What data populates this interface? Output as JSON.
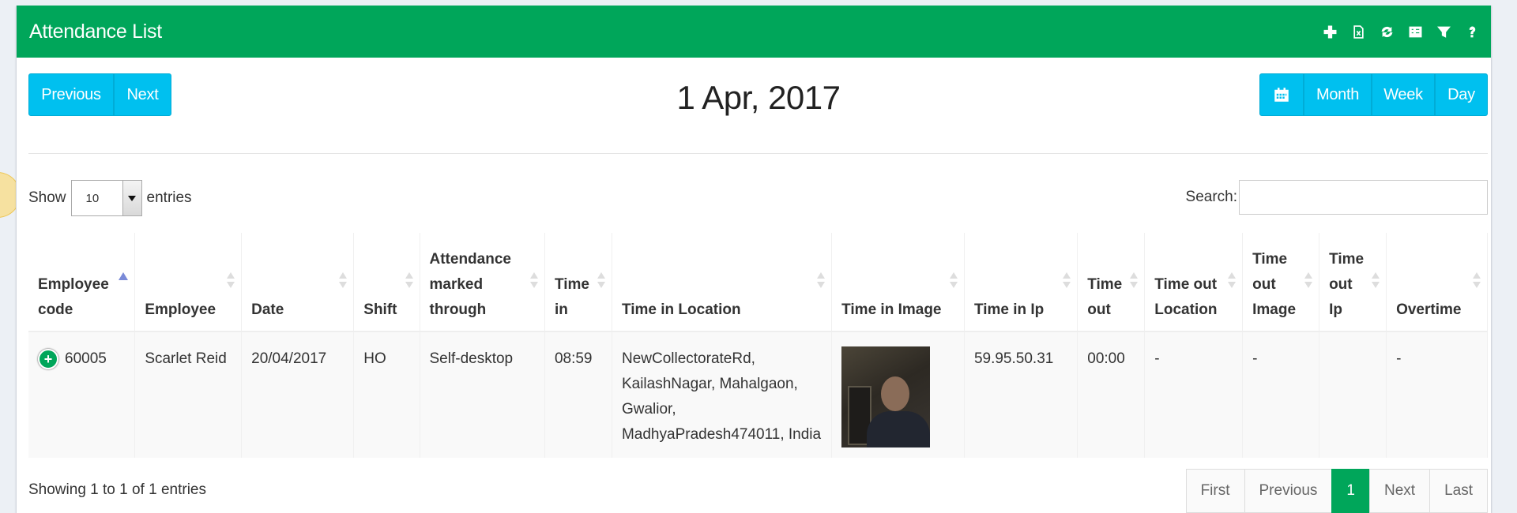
{
  "panel": {
    "title": "Attendance List"
  },
  "tools": [
    {
      "name": "add-icon"
    },
    {
      "name": "export-excel-icon"
    },
    {
      "name": "refresh-icon"
    },
    {
      "name": "columns-icon"
    },
    {
      "name": "filter-icon"
    },
    {
      "name": "help-icon"
    }
  ],
  "nav": {
    "previous": "Previous",
    "next": "Next"
  },
  "date_title": "1 Apr, 2017",
  "view": {
    "month": "Month",
    "week": "Week",
    "day": "Day"
  },
  "length": {
    "show": "Show",
    "value": "10",
    "entries": "entries"
  },
  "search": {
    "label": "Search:",
    "value": ""
  },
  "columns": [
    "Employee code",
    "Employee",
    "Date",
    "Shift",
    "Attendance marked through",
    "Time in",
    "Time in Location",
    "Time in Image",
    "Time in Ip",
    "Time out",
    "Time out Location",
    "Time out Image",
    "Time out Ip",
    "Overtime"
  ],
  "rows": [
    {
      "employee_code": "60005",
      "employee": "Scarlet Reid",
      "date": "20/04/2017",
      "shift": "HO",
      "marked_through": "Self-desktop",
      "time_in": "08:59",
      "time_in_location": "NewCollectorateRd, KailashNagar, Mahalgaon, Gwalior, MadhyaPradesh474011, India",
      "time_in_ip": "59.95.50.31",
      "time_out": "00:00",
      "time_out_location": "-",
      "time_out_image": "-",
      "time_out_ip": "",
      "overtime": "-"
    }
  ],
  "info": "Showing 1 to 1 of 1 entries",
  "pagination": {
    "first": "First",
    "previous": "Previous",
    "current": "1",
    "next": "Next",
    "last": "Last"
  }
}
